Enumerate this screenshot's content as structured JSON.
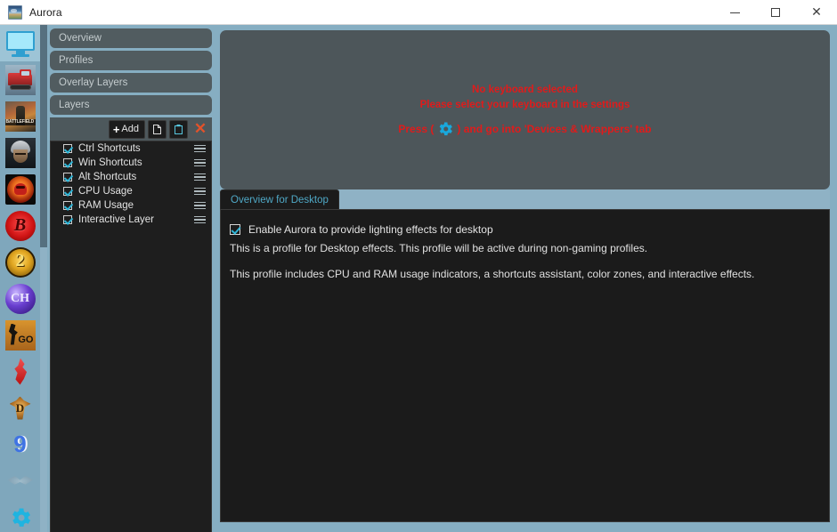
{
  "window": {
    "title": "Aurora",
    "app_icon": "aurora-logo-icon",
    "minimize_label": "Minimize",
    "maximize_label": "Maximize",
    "close_label": "Close"
  },
  "rail": {
    "items": [
      {
        "name": "desktop",
        "icon": "monitor-icon",
        "active": true
      },
      {
        "name": "euro-truck",
        "icon": "truck-icon",
        "active": false
      },
      {
        "name": "battlefield",
        "icon": "battlefield-icon",
        "active": false
      },
      {
        "name": "soldier-game",
        "icon": "soldier-icon",
        "active": false
      },
      {
        "name": "red-skull",
        "icon": "skull-icon",
        "active": false
      },
      {
        "name": "bs-logo",
        "icon": "bs-logo-icon",
        "active": false
      },
      {
        "name": "payday-2",
        "icon": "payday2-icon",
        "active": false
      },
      {
        "name": "clone-hero",
        "icon": "clone-hero-icon",
        "active": false
      },
      {
        "name": "csgo",
        "icon": "csgo-icon",
        "active": false
      },
      {
        "name": "red-flame",
        "icon": "flame-icon",
        "active": false
      },
      {
        "name": "diablo",
        "icon": "diablo-icon",
        "active": false
      },
      {
        "name": "gta-nine",
        "icon": "blue-nine-icon",
        "active": false
      },
      {
        "name": "wings",
        "icon": "wings-icon",
        "active": false
      },
      {
        "name": "settings",
        "icon": "gear-icon",
        "active": false
      }
    ]
  },
  "nav": {
    "buttons": [
      {
        "label": "Overview"
      },
      {
        "label": "Profiles"
      },
      {
        "label": "Overlay Layers"
      },
      {
        "label": "Layers"
      }
    ]
  },
  "layers_toolbar": {
    "add_label": "Add",
    "add_plus": "+",
    "copy_icon": "copy-icon",
    "paste_icon": "paste-icon",
    "delete_icon": "delete-x-icon",
    "delete_glyph": "✕"
  },
  "layers": {
    "items": [
      {
        "label": "Ctrl Shortcuts",
        "checked": true
      },
      {
        "label": "Win Shortcuts",
        "checked": true
      },
      {
        "label": "Alt Shortcuts",
        "checked": true
      },
      {
        "label": "CPU Usage",
        "checked": true
      },
      {
        "label": "RAM Usage",
        "checked": true
      },
      {
        "label": "Interactive Layer",
        "checked": true
      }
    ]
  },
  "preview": {
    "warning_line1": "No keyboard selected",
    "warning_line2": "Please select your keyboard in the settings",
    "warning_line3_pre": "Press (",
    "warning_gear_icon": "gear-icon",
    "warning_line3_post": ") and go into 'Devices & Wrappers' tab",
    "warning_color": "#e01b1b",
    "gear_color": "#19a8dc"
  },
  "tabs": {
    "active_tab_label": "Overview for Desktop",
    "active_tab_color": "#4fa8c6"
  },
  "overview": {
    "enable_checkbox_label": "Enable Aurora to provide lighting effects for desktop",
    "enable_checked": true,
    "paragraph_1": "This is a profile for Desktop effects. This profile will be active during non-gaming profiles.",
    "paragraph_2": "This profile includes CPU and RAM usage indicators, a shortcuts assistant, color zones, and interactive effects."
  },
  "theme": {
    "window_bg": "#86aec2",
    "panel_dark": "#1b1b1b",
    "nav_button_bg": "#515c60",
    "preview_bg": "#4d565a",
    "accent_cyan": "#2fb6d8"
  }
}
